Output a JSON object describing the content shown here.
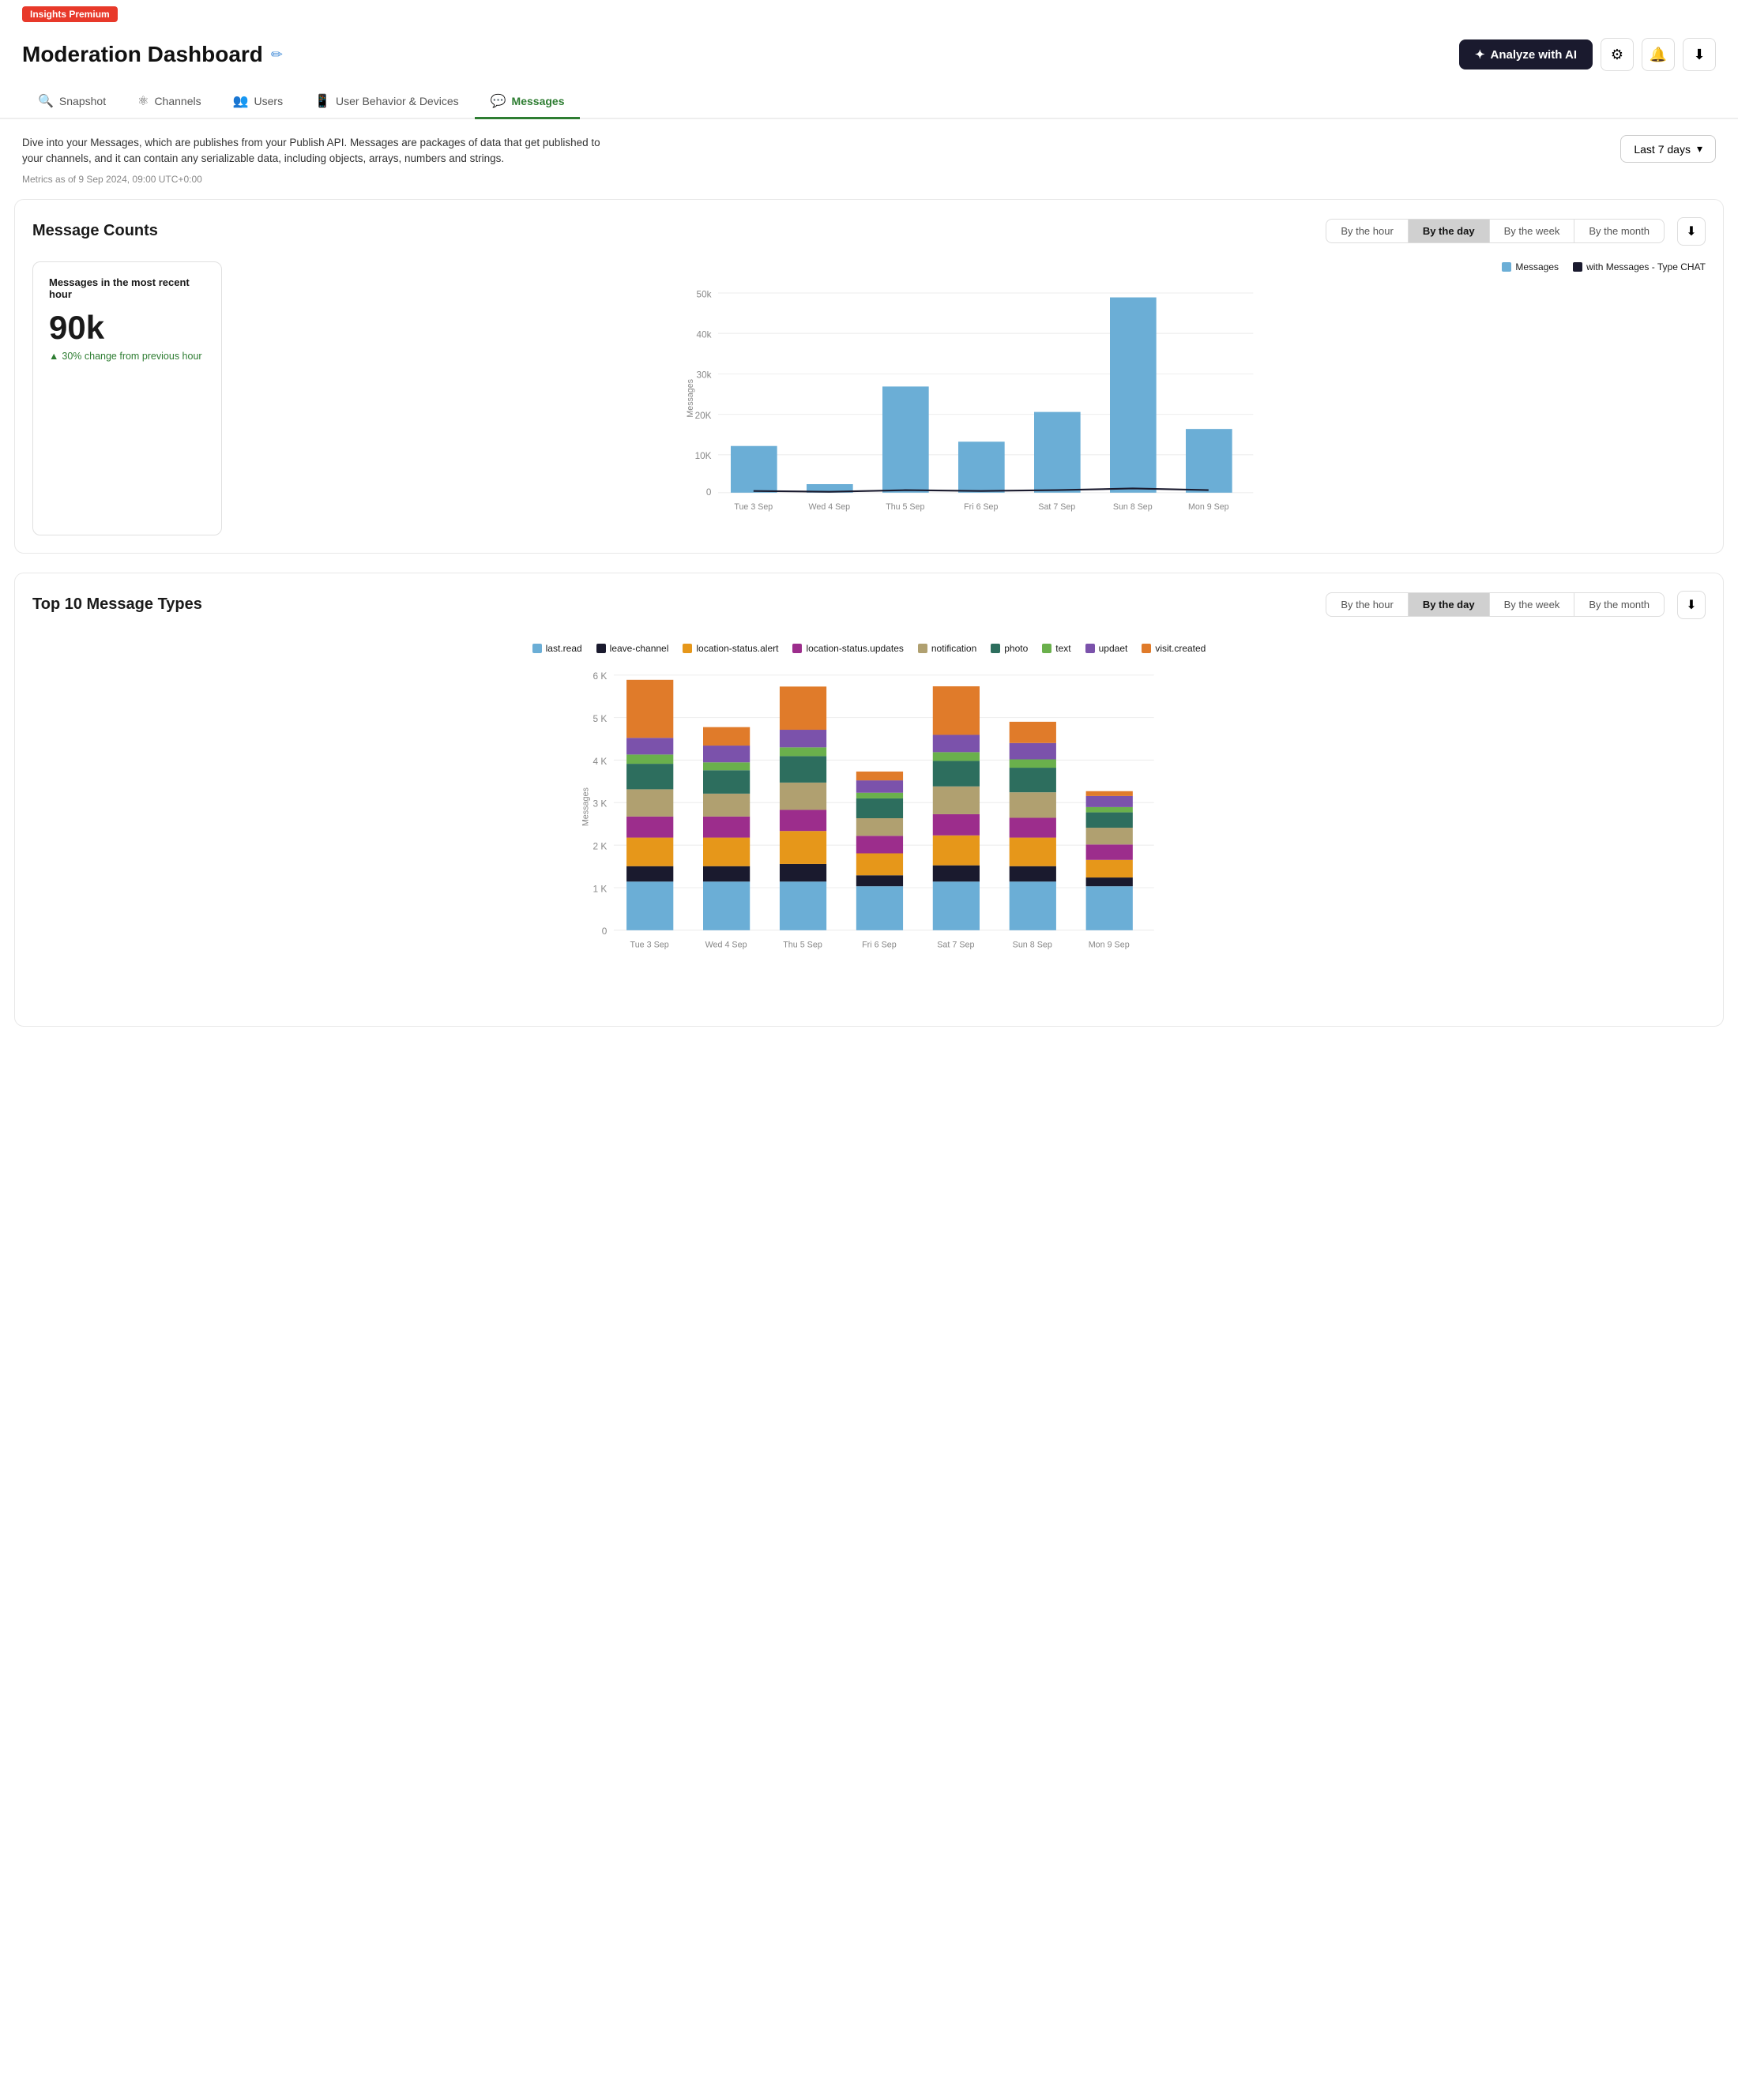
{
  "premium_badge": "Insights Premium",
  "page_title": "Moderation Dashboard",
  "edit_icon": "✏",
  "analyze_btn": "Analyze with AI",
  "ai_icon": "✦",
  "nav": {
    "tabs": [
      {
        "label": "Snapshot",
        "icon": "🔍",
        "active": false
      },
      {
        "label": "Channels",
        "icon": "⚛",
        "active": false
      },
      {
        "label": "Users",
        "icon": "👥",
        "active": false
      },
      {
        "label": "User Behavior & Devices",
        "icon": "📱",
        "active": false
      },
      {
        "label": "Messages",
        "icon": "💬",
        "active": true
      }
    ]
  },
  "description": "Dive into your Messages, which are publishes from your Publish API. Messages are packages of data that get published to your channels, and it can contain any serializable data, including objects, arrays, numbers and strings.",
  "date_range": "Last 7 days",
  "metrics_date": "Metrics as of 9 Sep 2024, 09:00 UTC+0:00",
  "message_counts": {
    "title": "Message Counts",
    "tabs": [
      "By the hour",
      "By the day",
      "By the week",
      "By the month"
    ],
    "active_tab": "By the day",
    "stat_label": "Messages in the most recent hour",
    "stat_value": "90k",
    "stat_change": "30% change from previous hour",
    "legend": [
      {
        "label": "Messages",
        "color": "#6baed6"
      },
      {
        "label": "with Messages - Type CHAT",
        "color": "#1a1a2e"
      }
    ],
    "x_labels": [
      "Tue 3 Sep",
      "Wed 4 Sep",
      "Thu 5 Sep",
      "Fri 6 Sep",
      "Sat 7 Sep",
      "Sun 8 Sep",
      "Mon 9 Sep"
    ],
    "bars": [
      11000,
      2000,
      25000,
      12000,
      19000,
      46000,
      15000
    ],
    "line": [
      300,
      200,
      500,
      400,
      600,
      1200,
      800
    ],
    "y_max": 50000
  },
  "top_message_types": {
    "title": "Top 10 Message Types",
    "tabs": [
      "By the hour",
      "By the day",
      "By the week",
      "By the month"
    ],
    "active_tab": "By the day",
    "legend": [
      {
        "label": "last.read",
        "color": "#6baed6"
      },
      {
        "label": "leave-channel",
        "color": "#1a1a2e"
      },
      {
        "label": "location-status.alert",
        "color": "#e6971a"
      },
      {
        "label": "location-status.updates",
        "color": "#9c2d8c"
      },
      {
        "label": "notification",
        "color": "#b0a070"
      },
      {
        "label": "photo",
        "color": "#2d6e5e"
      },
      {
        "label": "text",
        "color": "#6ab04c"
      },
      {
        "label": "updaet",
        "color": "#7b52ab"
      },
      {
        "label": "visit.created",
        "color": "#e07b2a"
      }
    ],
    "x_labels": [
      "Tue 3 Sep",
      "Wed 4 Sep",
      "Thu 5 Sep",
      "Fri 6 Sep",
      "Sat 7 Sep",
      "Sun 8 Sep",
      "Mon 9 Sep"
    ],
    "stacks": [
      [
        1100,
        350,
        650,
        480,
        620,
        580,
        210,
        380,
        1300
      ],
      [
        1100,
        350,
        650,
        480,
        520,
        530,
        180,
        380,
        420
      ],
      [
        1100,
        400,
        750,
        480,
        620,
        600,
        200,
        400,
        980
      ],
      [
        1000,
        250,
        500,
        400,
        400,
        450,
        130,
        280,
        200
      ],
      [
        1100,
        370,
        680,
        480,
        630,
        580,
        200,
        390,
        1100
      ],
      [
        1100,
        350,
        650,
        450,
        580,
        560,
        190,
        370,
        480
      ],
      [
        1000,
        200,
        400,
        350,
        380,
        350,
        120,
        250,
        100
      ]
    ],
    "y_max": 6000
  }
}
